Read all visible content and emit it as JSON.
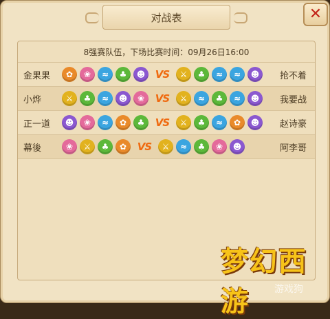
{
  "window": {
    "title": "对战表",
    "close_label": "✕"
  },
  "header": {
    "text": "8强赛队伍，下场比赛时间：09月26日16:00"
  },
  "vs_label": "VS",
  "sect_colors": {
    "orange": "#e98a2a",
    "pink": "#e46a9b",
    "blue": "#3ba5e0",
    "green": "#5cb83a",
    "purple": "#8b58d0",
    "gold": "#e2b21e"
  },
  "matches": [
    {
      "left": "金果果",
      "right": "抢不着",
      "left_sects": [
        "orange",
        "pink",
        "blue",
        "green",
        "purple"
      ],
      "right_sects": [
        "gold",
        "green",
        "blue",
        "blue",
        "purple"
      ]
    },
    {
      "left": "小烨",
      "right": "我要战",
      "left_sects": [
        "gold",
        "green",
        "blue",
        "purple",
        "pink"
      ],
      "right_sects": [
        "gold",
        "blue",
        "green",
        "blue",
        "purple"
      ]
    },
    {
      "left": "正一道",
      "right": "赵诗豪",
      "left_sects": [
        "purple",
        "pink",
        "blue",
        "orange",
        "green"
      ],
      "right_sects": [
        "gold",
        "green",
        "blue",
        "orange",
        "purple"
      ]
    },
    {
      "left": "幕後",
      "right": "阿李哥",
      "left_sects": [
        "pink",
        "gold",
        "green",
        "orange"
      ],
      "right_sects": [
        "gold",
        "blue",
        "green",
        "pink",
        "purple"
      ]
    }
  ],
  "logo": {
    "text": "梦幻西游",
    "watermark": "游戏狗"
  }
}
